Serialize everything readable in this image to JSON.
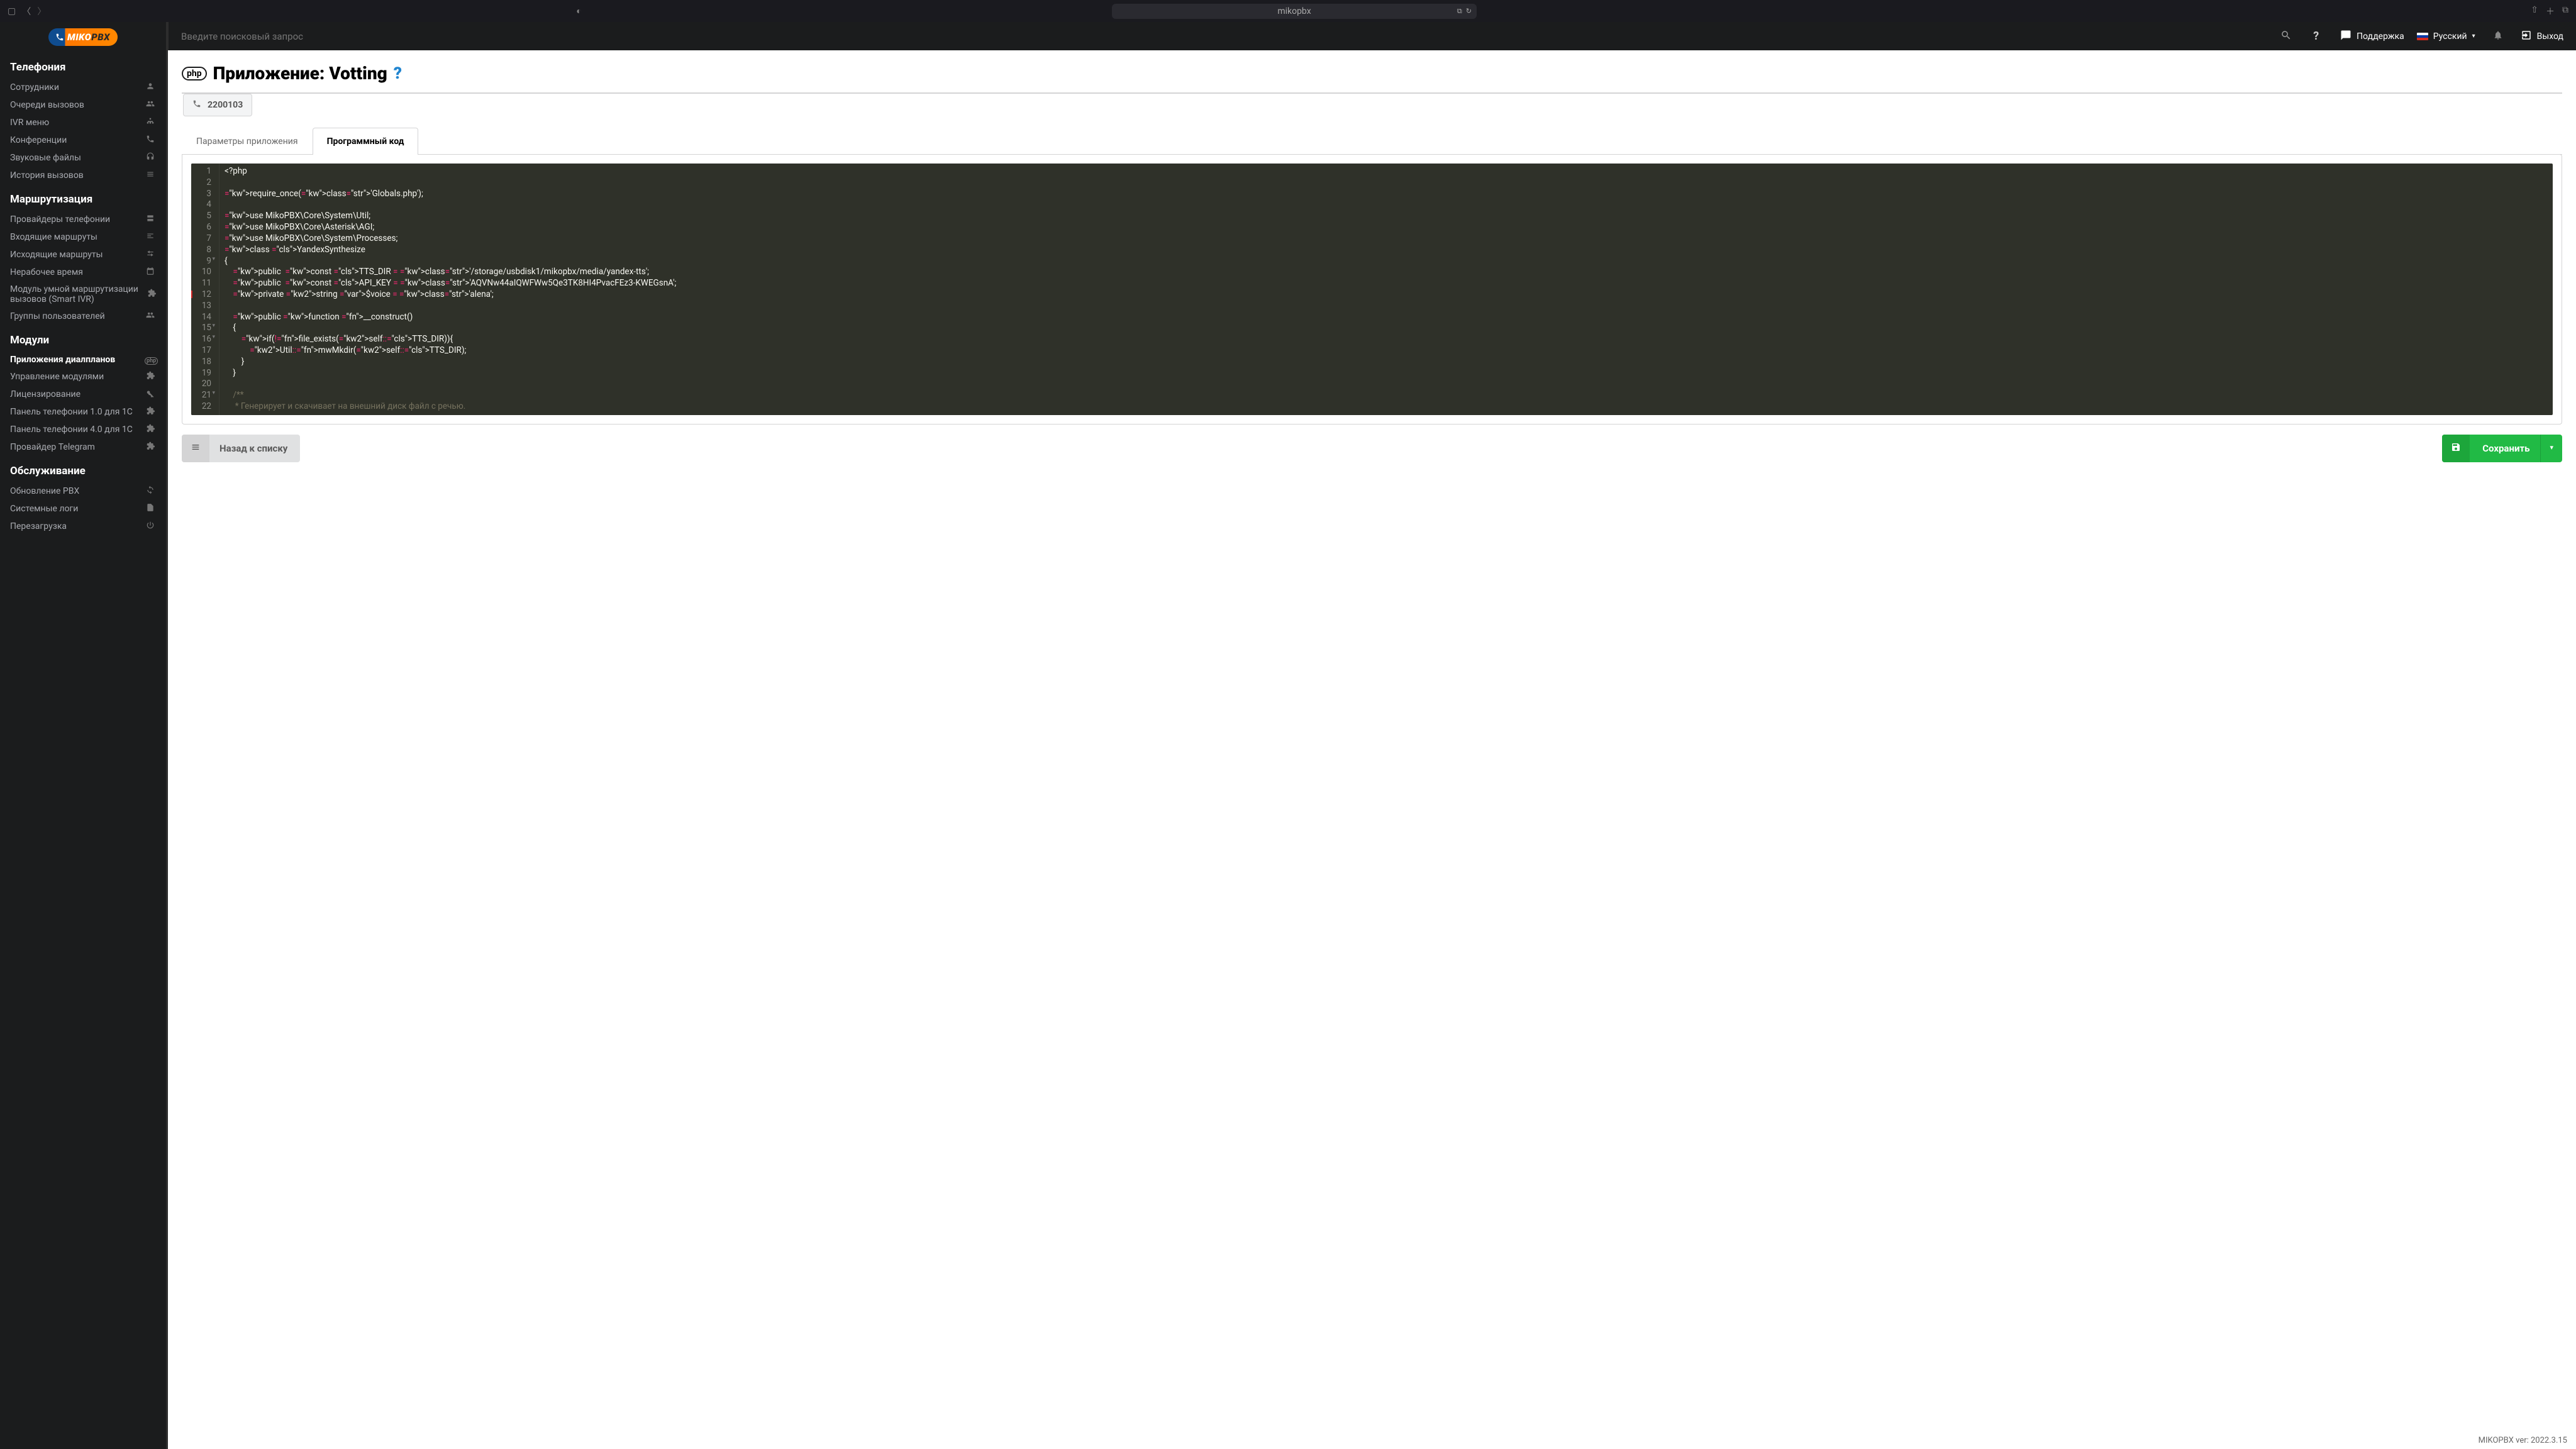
{
  "browser": {
    "url": "mikopbx"
  },
  "topbar": {
    "search_placeholder": "Введите поисковый запрос",
    "support": "Поддержка",
    "language": "Русский",
    "logout": "Выход"
  },
  "sidebar": {
    "logo_miko": "MIKO",
    "logo_pbx": "PBX",
    "sections": [
      {
        "title": "Телефония",
        "items": [
          {
            "label": "Сотрудники",
            "icon": "user"
          },
          {
            "label": "Очереди вызовов",
            "icon": "users"
          },
          {
            "label": "IVR меню",
            "icon": "sitemap"
          },
          {
            "label": "Конференции",
            "icon": "phone-vol"
          },
          {
            "label": "Звуковые файлы",
            "icon": "headphones"
          },
          {
            "label": "История вызовов",
            "icon": "list"
          }
        ]
      },
      {
        "title": "Маршрутизация",
        "items": [
          {
            "label": "Провайдеры телефонии",
            "icon": "server"
          },
          {
            "label": "Входящие маршруты",
            "icon": "in"
          },
          {
            "label": "Исходящие маршруты",
            "icon": "random"
          },
          {
            "label": "Нерабочее время",
            "icon": "calendar"
          },
          {
            "label": "Модуль умной маршрутизации вызовов (Smart IVR)",
            "icon": "puzzle"
          },
          {
            "label": "Группы пользователей",
            "icon": "users"
          }
        ]
      },
      {
        "title": "Модули",
        "items": [
          {
            "label": "Приложения диалпланов",
            "icon": "php",
            "active": true
          },
          {
            "label": "Управление модулями",
            "icon": "puzzle"
          },
          {
            "label": "Лицензирование",
            "icon": "key"
          },
          {
            "label": "Панель телефонии 1.0 для 1С",
            "icon": "puzzle"
          },
          {
            "label": "Панель телефонии 4.0 для 1С",
            "icon": "puzzle"
          },
          {
            "label": "Провайдер Telegram",
            "icon": "puzzle"
          }
        ]
      },
      {
        "title": "Обслуживание",
        "items": [
          {
            "label": "Обновление PBX",
            "icon": "sync"
          },
          {
            "label": "Системные логи",
            "icon": "file"
          },
          {
            "label": "Перезагрузка",
            "icon": "power"
          }
        ]
      }
    ]
  },
  "page": {
    "badge": "php",
    "title": "Приложение: Votting",
    "extension": "2200103",
    "tabs": [
      {
        "label": "Параметры приложения"
      },
      {
        "label": "Программный код",
        "active": true
      }
    ],
    "back_btn": "Назад к списку",
    "save_btn": "Сохранить",
    "version": "MIKOPBX ver: 2022.3.15"
  },
  "code_lines": [
    {
      "n": 1,
      "raw": "<?php"
    },
    {
      "n": 2,
      "raw": ""
    },
    {
      "n": 3,
      "raw": "require_once('Globals.php');"
    },
    {
      "n": 4,
      "raw": ""
    },
    {
      "n": 5,
      "raw": "use MikoPBX\\Core\\System\\Util;"
    },
    {
      "n": 6,
      "raw": "use MikoPBX\\Core\\Asterisk\\AGI;"
    },
    {
      "n": 7,
      "raw": "use MikoPBX\\Core\\System\\Processes;"
    },
    {
      "n": 8,
      "raw": "class YandexSynthesize"
    },
    {
      "n": 9,
      "raw": "{",
      "fold": true
    },
    {
      "n": 10,
      "raw": "    public  const TTS_DIR = '/storage/usbdisk1/mikopbx/media/yandex-tts';"
    },
    {
      "n": 11,
      "raw": "    public  const API_KEY = 'AQVNw44aIQWFWw5Qe3TK8HI4PvacFEz3-KWEGsnA';"
    },
    {
      "n": 12,
      "raw": "    private string $voice = 'alena';",
      "error": true
    },
    {
      "n": 13,
      "raw": ""
    },
    {
      "n": 14,
      "raw": "    public function __construct()"
    },
    {
      "n": 15,
      "raw": "    {",
      "fold": true
    },
    {
      "n": 16,
      "raw": "        if(!file_exists(self::TTS_DIR)){",
      "fold": true
    },
    {
      "n": 17,
      "raw": "            Util::mwMkdir(self::TTS_DIR);"
    },
    {
      "n": 18,
      "raw": "        }"
    },
    {
      "n": 19,
      "raw": "    }"
    },
    {
      "n": 20,
      "raw": ""
    },
    {
      "n": 21,
      "raw": "    /**",
      "fold": true
    },
    {
      "n": 22,
      "raw": "     * Генерирует и скачивает на внешний диск файл с речью."
    }
  ]
}
